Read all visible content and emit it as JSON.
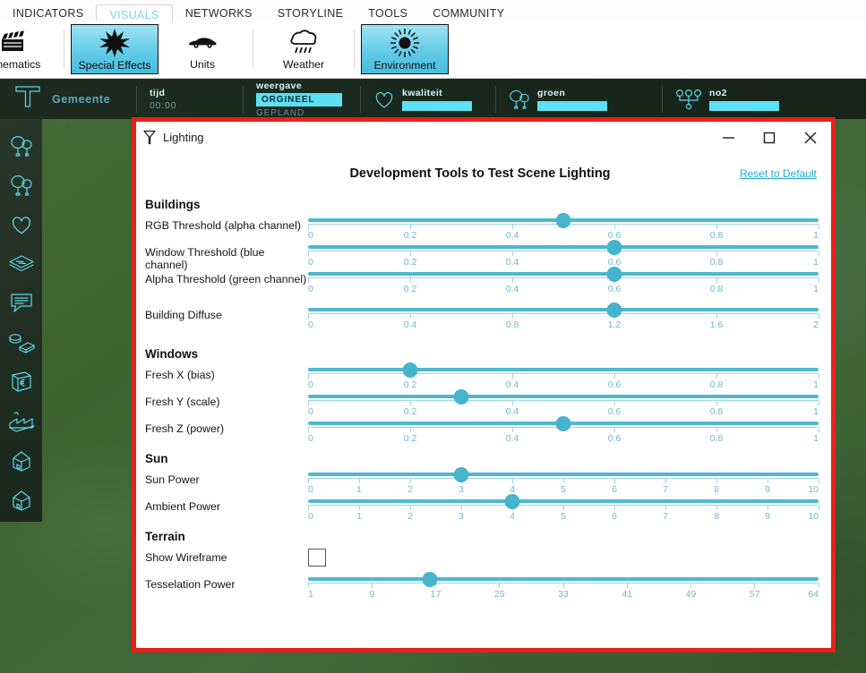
{
  "tabs": [
    {
      "label": "INDICATORS",
      "active": false
    },
    {
      "label": "VISUALS",
      "active": true
    },
    {
      "label": "NETWORKS",
      "active": false
    },
    {
      "label": "STORYLINE",
      "active": false
    },
    {
      "label": "TOOLS",
      "active": false
    },
    {
      "label": "COMMUNITY",
      "active": false
    }
  ],
  "ribbon": [
    {
      "label": "Cinematics",
      "icon": "clapperboard-icon",
      "selected": false
    },
    {
      "label": "Special Effects",
      "icon": "starburst-icon",
      "selected": true
    },
    {
      "label": "Units",
      "icon": "car-icon",
      "selected": false
    },
    {
      "label": "Weather",
      "icon": "rain-cloud-icon",
      "selected": false
    },
    {
      "label": "Environment",
      "icon": "sun-rays-icon",
      "selected": true
    }
  ],
  "hud": {
    "title": "Gemeente",
    "title_icon": "junction-icon",
    "cells": [
      {
        "key": "tijd",
        "value": "00:00",
        "icon": ""
      },
      {
        "key": "weergave",
        "chip": "ORGINEEL",
        "chip2": "GEPLAND",
        "icon": ""
      },
      {
        "key": "kwaliteit",
        "icon": "heart-icon",
        "bar": true
      },
      {
        "key": "groen",
        "icon": "trees-icon",
        "bar": true
      },
      {
        "key": "no2",
        "icon": "molecule-icon",
        "bar": true
      }
    ]
  },
  "rail": {
    "items": [
      {
        "icon": "trees-icon"
      },
      {
        "icon": "trees-icon"
      },
      {
        "icon": "heart-icon"
      },
      {
        "icon": "layers-icon"
      },
      {
        "icon": "speech-bubble-icon"
      },
      {
        "icon": "coins-icon"
      },
      {
        "icon": "euro-wallet-icon"
      },
      {
        "icon": "factory-icon"
      },
      {
        "icon": "house-icon"
      },
      {
        "icon": "house-icon"
      }
    ]
  },
  "dialog": {
    "title": "Lighting",
    "title_icon": "lighting-fixture-icon",
    "heading": "Development Tools to Test Scene Lighting",
    "reset_label": "Reset to Default",
    "window_controls": {
      "minimize": "minimize-icon",
      "maximize": "maximize-icon",
      "close": "close-icon"
    },
    "sections": [
      {
        "name": "Buildings",
        "controls": [
          {
            "type": "slider",
            "label": "RGB Threshold (alpha channel)",
            "value": 0.5,
            "min": 0,
            "max": 1,
            "ticks": [
              "0",
              "0.2",
              "0.4",
              "0.6",
              "0.8",
              "1"
            ],
            "spacer": false
          },
          {
            "type": "slider",
            "label": "Window Threshold (blue channel)",
            "value": 0.6,
            "min": 0,
            "max": 1,
            "ticks": [
              "0",
              "0.2",
              "0.4",
              "0.6",
              "0.8",
              "1"
            ],
            "spacer": false
          },
          {
            "type": "slider",
            "label": "Alpha Threshold (green channel)",
            "value": 0.6,
            "min": 0,
            "max": 1,
            "ticks": [
              "0",
              "0.2",
              "0.4",
              "0.6",
              "0.8",
              "1"
            ],
            "spacer": false
          },
          {
            "type": "slider",
            "label": "Building Diffuse",
            "value": 1.2,
            "min": 0,
            "max": 2,
            "ticks": [
              "0",
              "0.4",
              "0.8",
              "1.2",
              "1.6",
              "2"
            ],
            "spacer": true
          }
        ]
      },
      {
        "name": "Windows",
        "controls": [
          {
            "type": "slider",
            "label": "Fresh X (bias)",
            "value": 0.2,
            "min": 0,
            "max": 1,
            "ticks": [
              "0",
              "0.2",
              "0.4",
              "0.6",
              "0.8",
              "1"
            ],
            "spacer": false
          },
          {
            "type": "slider",
            "label": "Fresh Y (scale)",
            "value": 0.3,
            "min": 0,
            "max": 1,
            "ticks": [
              "0",
              "0.2",
              "0.4",
              "0.6",
              "0.8",
              "1"
            ],
            "spacer": false
          },
          {
            "type": "slider",
            "label": "Fresh Z (power)",
            "value": 0.5,
            "min": 0,
            "max": 1,
            "ticks": [
              "0",
              "0.2",
              "0.4",
              "0.6",
              "0.8",
              "1"
            ],
            "spacer": false
          }
        ]
      },
      {
        "name": "Sun",
        "controls": [
          {
            "type": "slider",
            "label": "Sun Power",
            "value": 3,
            "min": 0,
            "max": 10,
            "ticks": [
              "0",
              "1",
              "2",
              "3",
              "4",
              "5",
              "6",
              "7",
              "8",
              "9",
              "10"
            ],
            "spacer": false
          },
          {
            "type": "slider",
            "label": "Ambient Power",
            "value": 4,
            "min": 0,
            "max": 10,
            "ticks": [
              "0",
              "1",
              "2",
              "3",
              "4",
              "5",
              "6",
              "7",
              "8",
              "9",
              "10"
            ],
            "spacer": false
          }
        ]
      },
      {
        "name": "Terrain",
        "controls": [
          {
            "type": "checkbox",
            "label": "Show Wireframe",
            "checked": false
          },
          {
            "type": "slider",
            "label": "Tesselation Power",
            "value": 16,
            "min": 1,
            "max": 64,
            "ticks": [
              "1",
              "9",
              "17",
              "25",
              "33",
              "41",
              "49",
              "57",
              "64"
            ],
            "spacer": false
          }
        ]
      }
    ]
  },
  "colors": {
    "accent_cyan": "#5ce0f2",
    "slider_teal": "#4db8cf",
    "tick_label": "#6fb8cd",
    "dialog_border_red": "#e8201c",
    "tab_active_text": "#7fd3e8",
    "link_blue": "#29a8d0",
    "terrain_green": "#3f6633"
  }
}
